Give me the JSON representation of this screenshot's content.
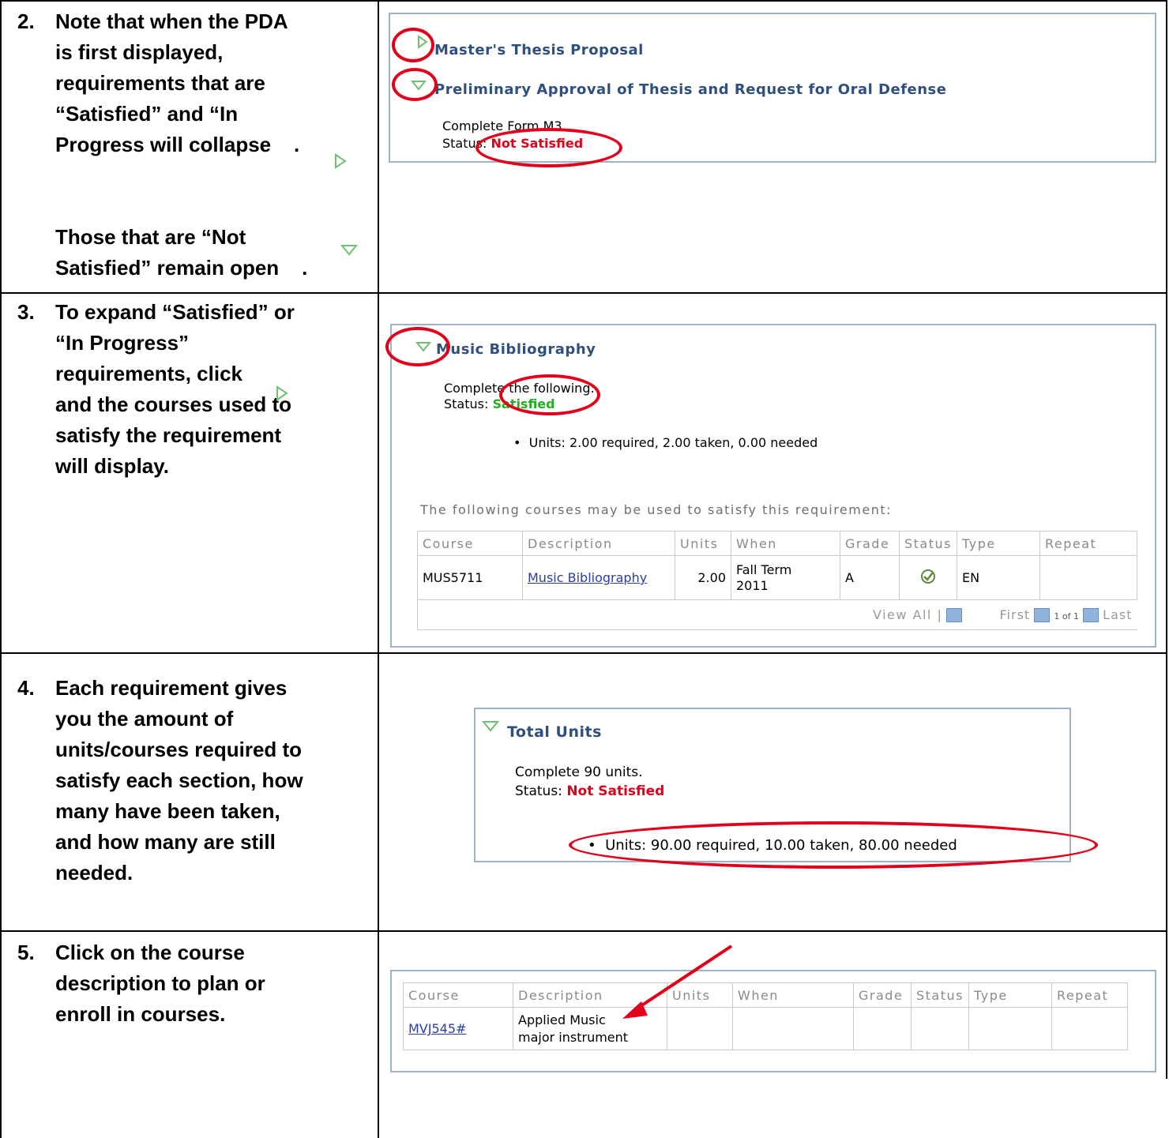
{
  "steps": [
    {
      "num": "2.",
      "text": "Note that when the PDA\nis first displayed,\nrequirements that are\n“Satisfied” and “In\nProgress will collapse    .\n\n\nThose that are “Not\nSatisfied” remain open    ."
    },
    {
      "num": "3.",
      "text": "To expand “Satisfied” or\n“In Progress”\nrequirements, click\nand the courses used to\nsatisfy the requirement\nwill display."
    },
    {
      "num": "4.",
      "text": "Each requirement gives\nyou the amount of\nunits/courses required to\nsatisfy each section, how\nmany have been taken,\nand how many are still\nneeded."
    },
    {
      "num": "5.",
      "text": "Click on the course\ndescription to plan or\nenroll in courses."
    }
  ],
  "panel1": {
    "req1": "Master's Thesis Proposal",
    "req2": "Preliminary Approval of Thesis and Request for Oral Defense",
    "line1": "Complete Form M3.",
    "status_label": "Status: ",
    "status_value": "Not Satisfied"
  },
  "panel2": {
    "title": "Music Bibliography",
    "line1": "Complete the following:",
    "status_label": "Status: ",
    "status_value": "Satisfied",
    "units": "Units: 2.00 required, 2.00 taken, 0.00 needed",
    "courses_caption": "The following courses may be used to satisfy this requirement:",
    "headers": [
      "Course",
      "Description",
      "Units",
      "When",
      "Grade",
      "Status",
      "Type",
      "Repeat"
    ],
    "row": {
      "course": "MUS5711",
      "description": "Music Bibliography",
      "units": "2.00",
      "when_1": "Fall Term",
      "when_2": "2011",
      "grade": "A",
      "type": "EN",
      "repeat": ""
    },
    "view_all": "View All |",
    "first": "First",
    "page_of": "1 of 1",
    "last": "Last"
  },
  "panel3": {
    "title": "Total Units",
    "line1": "Complete 90 units.",
    "status_label": "Status: ",
    "status_value": "Not Satisfied",
    "units": "Units: 90.00 required, 10.00 taken, 80.00 needed"
  },
  "panel4": {
    "headers": [
      "Course",
      "Description",
      "Units",
      "When",
      "Grade",
      "Status",
      "Type",
      "Repeat"
    ],
    "row": {
      "course": "MVJ545#",
      "description_1": "Applied Music",
      "description_2": "major instrument"
    }
  },
  "colors": {
    "accent_title": "#2f4f7f",
    "annotation_red": "#e3001b",
    "status_red": "#e1001b",
    "status_green": "#22b022",
    "triangle_green": "#6fc06f"
  }
}
